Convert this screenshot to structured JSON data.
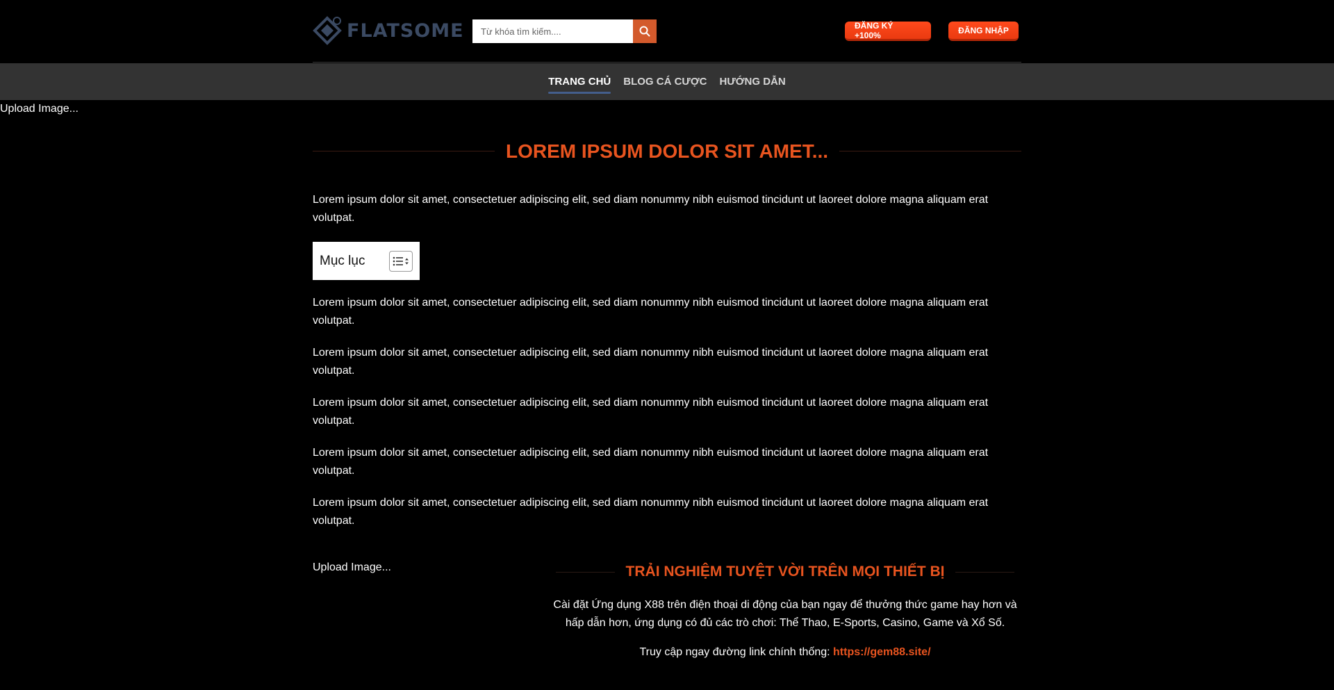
{
  "header": {
    "logo_text": "FLATSOME",
    "search_placeholder": "Từ khóa tìm kiếm....",
    "register_label": "ĐĂNG KÝ +100%",
    "login_label": "ĐĂNG NHẬP"
  },
  "nav": {
    "items": [
      {
        "label": "TRANG CHỦ",
        "active": true
      },
      {
        "label": "BLOG CÁ CƯỢC",
        "active": false
      },
      {
        "label": "HƯỚNG DẪN",
        "active": false
      }
    ]
  },
  "upload_placeholder_top": "Upload Image...",
  "main": {
    "title": "LOREM IPSUM DOLOR SIT AMET...",
    "intro": "Lorem ipsum dolor sit amet, consectetuer adipiscing elit, sed diam nonummy nibh euismod tincidunt ut laoreet dolore magna aliquam erat volutpat.",
    "toc_title": "Mục lục",
    "paragraphs": [
      "Lorem ipsum dolor sit amet, consectetuer adipiscing elit, sed diam nonummy nibh euismod tincidunt ut laoreet dolore magna aliquam erat volutpat.",
      "Lorem ipsum dolor sit amet, consectetuer adipiscing elit, sed diam nonummy nibh euismod tincidunt ut laoreet dolore magna aliquam erat volutpat.",
      "Lorem ipsum dolor sit amet, consectetuer adipiscing elit, sed diam nonummy nibh euismod tincidunt ut laoreet dolore magna aliquam erat volutpat.",
      "Lorem ipsum dolor sit amet, consectetuer adipiscing elit, sed diam nonummy nibh euismod tincidunt ut laoreet dolore magna aliquam erat volutpat.",
      "Lorem ipsum dolor sit amet, consectetuer adipiscing elit, sed diam nonummy nibh euismod tincidunt ut laoreet dolore magna aliquam erat volutpat."
    ]
  },
  "bottom": {
    "upload_placeholder": "Upload Image...",
    "app_title": "TRẢI NGHIỆM TUYỆT VỜI TRÊN MỌI THIẾT BỊ",
    "app_desc": "Cài đặt Ứng dụng X88 trên điện thoại di động của bạn ngay để thưởng thức game hay hơn và hấp dẫn hơn, ứng dụng có đủ các trò chơi: Thể Thao, E-Sports, Casino, Game và Xổ Số.",
    "link_prefix": "Truy cập ngay đường link chính thống: ",
    "link_text": "https://gem88.site/"
  },
  "colors": {
    "accent": "#e8541f",
    "nav_bg": "#333333",
    "active_underline": "#445e8c",
    "logo": "#3b4a63"
  }
}
